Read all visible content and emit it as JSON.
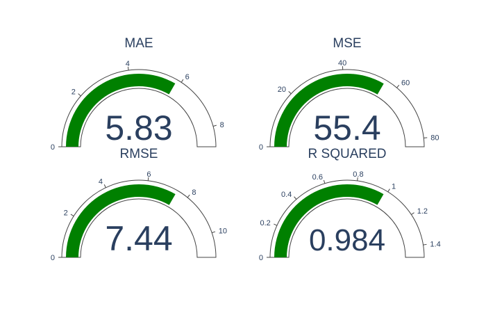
{
  "chart_data": [
    {
      "type": "gauge",
      "title": "MAE",
      "value": 5.83,
      "value_text": "5.83",
      "range": [
        0,
        8.75
      ],
      "ticks": [
        0,
        2,
        4,
        6,
        8
      ],
      "tick_labels": [
        "0",
        "2",
        "4",
        "6",
        "8"
      ],
      "bar_color": "#008000"
    },
    {
      "type": "gauge",
      "title": "MSE",
      "value": 55.4,
      "value_text": "55.4",
      "range": [
        0,
        83
      ],
      "ticks": [
        0,
        20,
        40,
        60,
        80
      ],
      "tick_labels": [
        "0",
        "20",
        "40",
        "60",
        "80"
      ],
      "bar_color": "#008000"
    },
    {
      "type": "gauge",
      "title": "RMSE",
      "value": 7.44,
      "value_text": "7.44",
      "range": [
        0,
        11.15
      ],
      "ticks": [
        0,
        2,
        4,
        6,
        8,
        10
      ],
      "tick_labels": [
        "0",
        "2",
        "4",
        "6",
        "8",
        "10"
      ],
      "bar_color": "#008000"
    },
    {
      "type": "gauge",
      "title": "R SQUARED",
      "value": 0.984,
      "value_text": "0.984",
      "range": [
        0,
        1.476
      ],
      "ticks": [
        0,
        0.2,
        0.4,
        0.6,
        0.8,
        1,
        1.2,
        1.4
      ],
      "tick_labels": [
        "0",
        "0.2",
        "0.4",
        "0.6",
        "0.8",
        "1",
        "1.2",
        "1.4"
      ],
      "bar_color": "#008000"
    }
  ]
}
